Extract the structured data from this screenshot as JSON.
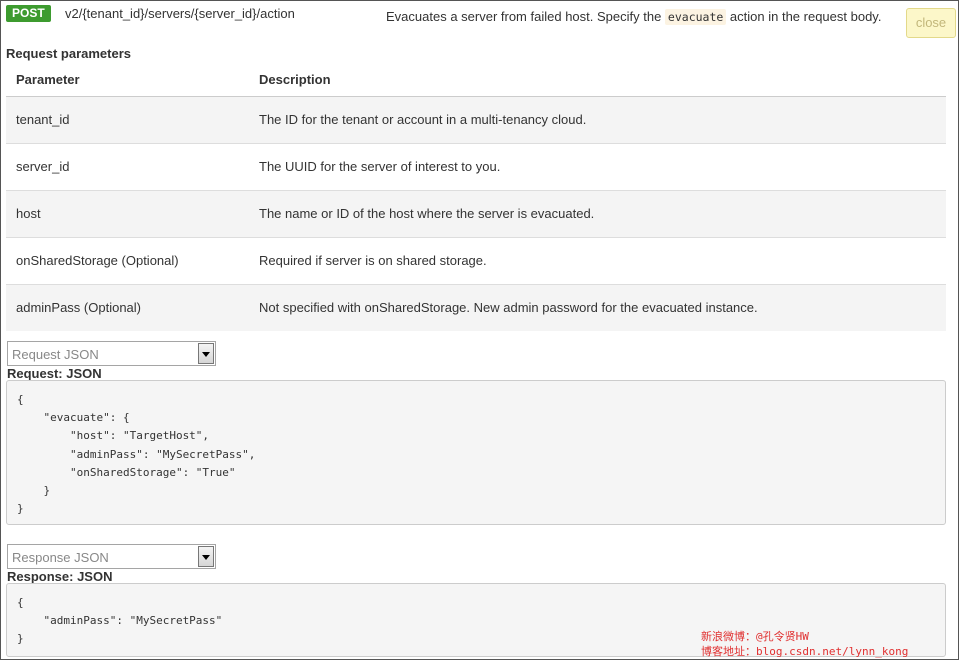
{
  "endpoint": {
    "method": "POST",
    "path": "v2/{tenant_id}/servers/{server_id}/action",
    "summary_before": "Evacuates a server from failed host. Specify the ",
    "summary_code": "evacuate",
    "summary_after": " action in the request body.",
    "close_label": "close"
  },
  "request_parameters": {
    "heading": "Request parameters",
    "columns": [
      "Parameter",
      "Description"
    ],
    "rows": [
      {
        "parameter": "tenant_id",
        "description": "The ID for the tenant or account in a multi-tenancy cloud."
      },
      {
        "parameter": "server_id",
        "description": "The UUID for the server of interest to you."
      },
      {
        "parameter": "host",
        "description": "The name or ID of the host where the server is evacuated."
      },
      {
        "parameter": "onSharedStorage (Optional)",
        "description": "Required if server is on shared storage."
      },
      {
        "parameter": "adminPass (Optional)",
        "description": "Not specified with onSharedStorage. New admin password for the evacuated instance."
      }
    ]
  },
  "request_example": {
    "select_value": "Request JSON",
    "label": "Request: JSON",
    "code": "{\n    \"evacuate\": {\n        \"host\": \"TargetHost\",\n        \"adminPass\": \"MySecretPass\",\n        \"onSharedStorage\": \"True\"\n    }\n}"
  },
  "response_example": {
    "select_value": "Response JSON",
    "label": "Response: JSON",
    "code": "{\n    \"adminPass\": \"MySecretPass\"\n}"
  },
  "watermark": {
    "line1": "新浪微博：@孔令贤HW",
    "line2": "博客地址：blog.csdn.net/lynn_kong"
  },
  "colors": {
    "method_badge": "#3d9b2f",
    "close_button_bg": "#fcf7c9",
    "watermark": "#e03030"
  }
}
